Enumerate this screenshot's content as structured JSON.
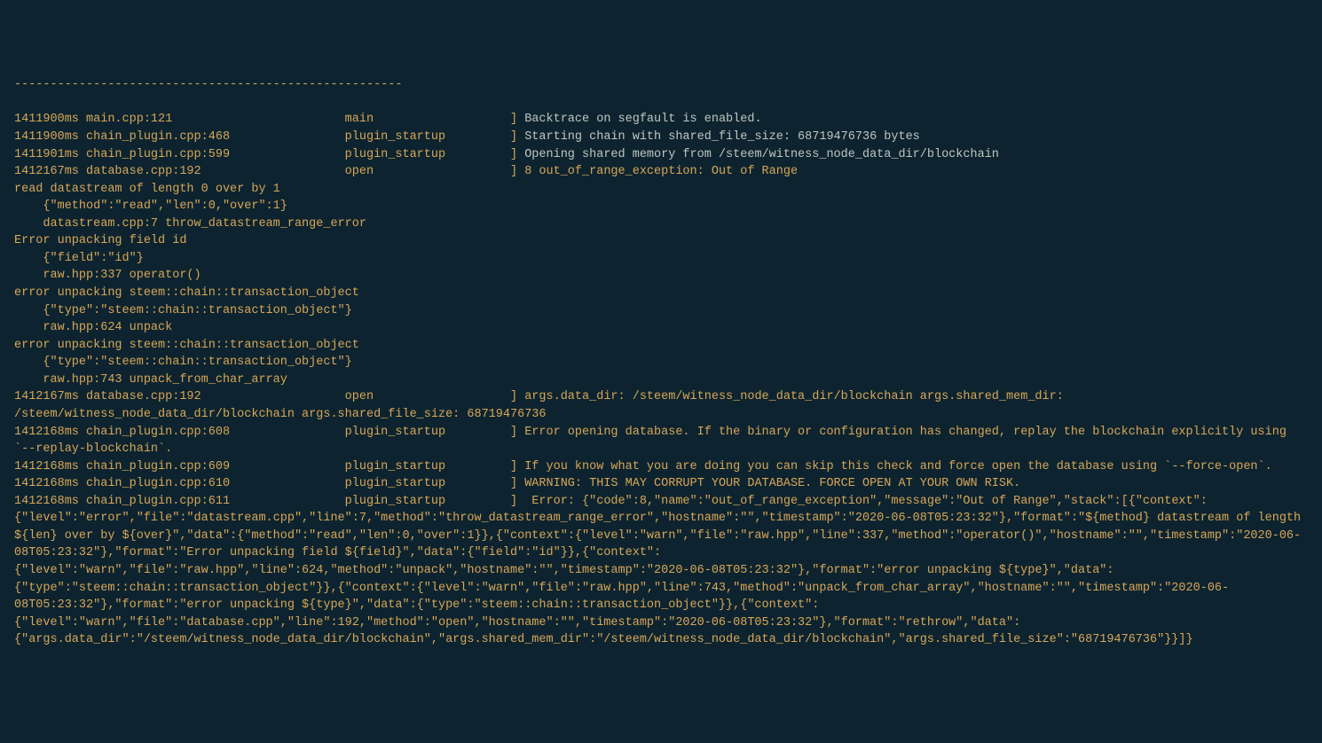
{
  "separator": "------------------------------------------------------",
  "lines": [
    {
      "ts": "1411900ms ",
      "src": "main.cpp:121",
      "fn": "main",
      "msg": "Backtrace on segfault is enabled.",
      "white_msg": true
    },
    {
      "ts": "1411900ms ",
      "src": "chain_plugin.cpp:468",
      "fn": "plugin_startup",
      "msg": "Starting chain with shared_file_size: 68719476736 bytes",
      "white_msg": true
    },
    {
      "ts": "1411901ms ",
      "src": "chain_plugin.cpp:599",
      "fn": "plugin_startup",
      "msg": "Opening shared memory from /steem/witness_node_data_dir/blockchain",
      "white_msg": true
    },
    {
      "ts": "1412167ms ",
      "src": "database.cpp:192",
      "fn": "open",
      "msg": "8 out_of_range_exception: Out of Range",
      "white_msg": false
    }
  ],
  "block1": [
    "read datastream of length 0 over by 1",
    "    {\"method\":\"read\",\"len\":0,\"over\":1}",
    "    datastream.cpp:7 throw_datastream_range_error",
    "Error unpacking field id",
    "    {\"field\":\"id\"}",
    "    raw.hpp:337 operator()",
    "error unpacking steem::chain::transaction_object",
    "    {\"type\":\"steem::chain::transaction_object\"}",
    "    raw.hpp:624 unpack",
    "error unpacking steem::chain::transaction_object",
    "    {\"type\":\"steem::chain::transaction_object\"}",
    "    raw.hpp:743 unpack_from_char_array"
  ],
  "lines2": [
    {
      "ts": "1412167ms ",
      "src": "database.cpp:192",
      "fn": "open",
      "msg": "args.data_dir: /steem/witness_node_data_dir/blockchain args.shared_mem_dir: /steem/witness_node_data_dir/blockchain args.shared_file_size: 68719476736",
      "wrap": true
    },
    {
      "ts": "1412168ms ",
      "src": "chain_plugin.cpp:608",
      "fn": "plugin_startup",
      "msg": "Error opening database. If the binary or configuration has changed, replay the blockchain explicitly using `--replay-blockchain`.",
      "wrap": true
    },
    {
      "ts": "1412168ms ",
      "src": "chain_plugin.cpp:609",
      "fn": "plugin_startup",
      "msg": "If you know what you are doing you can skip this check and force open the database using `--force-open`.",
      "wrap": true
    },
    {
      "ts": "1412168ms ",
      "src": "chain_plugin.cpp:610",
      "fn": "plugin_startup",
      "msg": "WARNING: THIS MAY CORRUPT YOUR DATABASE. FORCE OPEN AT YOUR OWN RISK.",
      "wrap": false
    },
    {
      "ts": "1412168ms ",
      "src": "chain_plugin.cpp:611",
      "fn": "plugin_startup",
      "msg": " Error: {\"code\":8,\"name\":\"out_of_range_exception\",\"message\":\"Out of Range\",\"stack\":[{\"context\":{\"level\":\"error\",\"file\":\"datastream.cpp\",\"line\":7,\"method\":\"throw_datastream_range_error\",\"hostname\":\"\",\"timestamp\":\"2020-06-08T05:23:32\"},\"format\":\"${method} datastream of length ${len} over by ${over}\",\"data\":{\"method\":\"read\",\"len\":0,\"over\":1}},{\"context\":{\"level\":\"warn\",\"file\":\"raw.hpp\",\"line\":337,\"method\":\"operator()\",\"hostname\":\"\",\"timestamp\":\"2020-06-08T05:23:32\"},\"format\":\"Error unpacking field ${field}\",\"data\":{\"field\":\"id\"}},{\"context\":{\"level\":\"warn\",\"file\":\"raw.hpp\",\"line\":624,\"method\":\"unpack\",\"hostname\":\"\",\"timestamp\":\"2020-06-08T05:23:32\"},\"format\":\"error unpacking ${type}\",\"data\":{\"type\":\"steem::chain::transaction_object\"}},{\"context\":{\"level\":\"warn\",\"file\":\"raw.hpp\",\"line\":743,\"method\":\"unpack_from_char_array\",\"hostname\":\"\",\"timestamp\":\"2020-06-08T05:23:32\"},\"format\":\"error unpacking ${type}\",\"data\":{\"type\":\"steem::chain::transaction_object\"}},{\"context\":{\"level\":\"warn\",\"file\":\"database.cpp\",\"line\":192,\"method\":\"open\",\"hostname\":\"\",\"timestamp\":\"2020-06-08T05:23:32\"},\"format\":\"rethrow\",\"data\":{\"args.data_dir\":\"/steem/witness_node_data_dir/blockchain\",\"args.shared_mem_dir\":\"/steem/witness_node_data_dir/blockchain\",\"args.shared_file_size\":\"68719476736\"}}]}",
      "wrap": true
    }
  ]
}
